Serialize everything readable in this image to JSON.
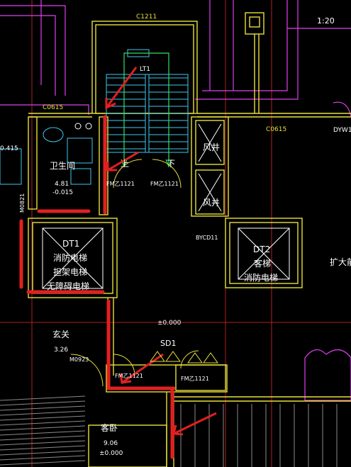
{
  "drawing": {
    "scale": "1:20",
    "top_window": "C1211",
    "stair_tag": "LT1",
    "stair_up": "上",
    "stair_down": "下",
    "wall_tags": {
      "left_window": "C0615",
      "right_window": "C0615",
      "right_code": "DYW1",
      "small_left": "0.415"
    },
    "bathroom": {
      "name": "卫生间",
      "area": "4.81",
      "level": "-0.015"
    },
    "doors": {
      "left": "FM乙1121",
      "right": "FM乙1121",
      "left_side": "M0821",
      "bottom_left": "FM乙1121",
      "bottom_right": "FM乙1121",
      "box": "BYCD11"
    },
    "shafts": {
      "upper": "风井",
      "lower": "风井"
    },
    "elevator_dt1": {
      "tag": "DT1",
      "line1": "消防电梯",
      "line2": "担架电梯",
      "line3": "无障碍电梯"
    },
    "elevator_dt2": {
      "tag": "DT2",
      "line1": "客梯",
      "line2": "消防电梯"
    },
    "level_mark": "±0.000",
    "sd_tag": "SD1",
    "foyer": {
      "name": "玄关",
      "area": "3.26",
      "door": "M0923"
    },
    "bedroom": {
      "name": "客卧",
      "area": "9.06",
      "level": "±0.000"
    },
    "right_label": "扩大前"
  },
  "colors": {
    "background": "#000000",
    "wall_yellow": "#e8e03a",
    "magenta": "#e040f0",
    "cyan": "#40c8f0",
    "green": "#30e060",
    "red_line": "#e02020",
    "white": "#ffffff",
    "blue": "#4060f0"
  }
}
